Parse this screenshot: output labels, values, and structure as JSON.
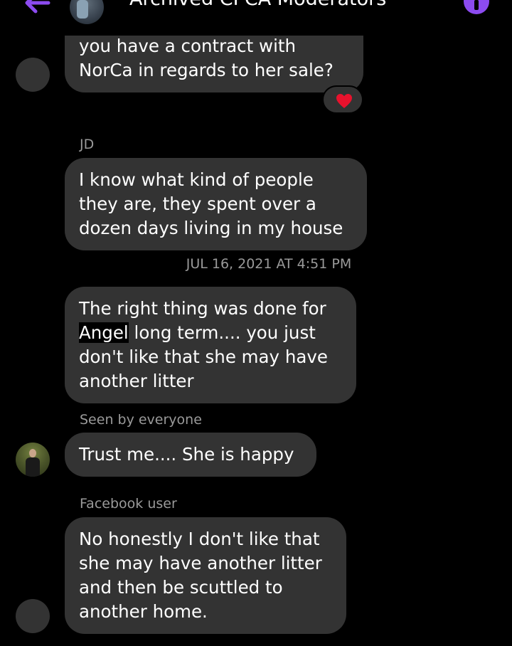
{
  "header": {
    "title": "Archived CPCA Moderators",
    "back_icon": "back-arrow-icon",
    "info_icon": "info-icon"
  },
  "colors": {
    "background": "#000000",
    "bubble": "#333333",
    "accent": "#8c4bf0",
    "meta_text": "#9a9a9a",
    "heart": "#e8122d"
  },
  "messages": [
    {
      "lines": [
        "you have a contract with",
        "NorCa in regards to her sale?"
      ],
      "reaction": "heart"
    },
    {
      "sender": "JD",
      "lines": [
        "I know what kind of people",
        "they are, they spent over a",
        "dozen days living in my house"
      ]
    },
    {
      "timestamp": "JUL 16, 2021 AT 4:51 PM",
      "line1": "The right thing was done for",
      "line2_highlight": "Angel",
      "line2_rest": " long term.... you just",
      "line3": "don't like that she may have",
      "line4": "another litter"
    },
    {
      "sender": "Seen by everyone",
      "lines": [
        "Trust me.... She is happy"
      ]
    },
    {
      "sender": "Facebook user",
      "lines": [
        "No honestly I don't like that",
        "she may have another litter",
        "and then be scuttled to",
        "another home."
      ]
    }
  ]
}
